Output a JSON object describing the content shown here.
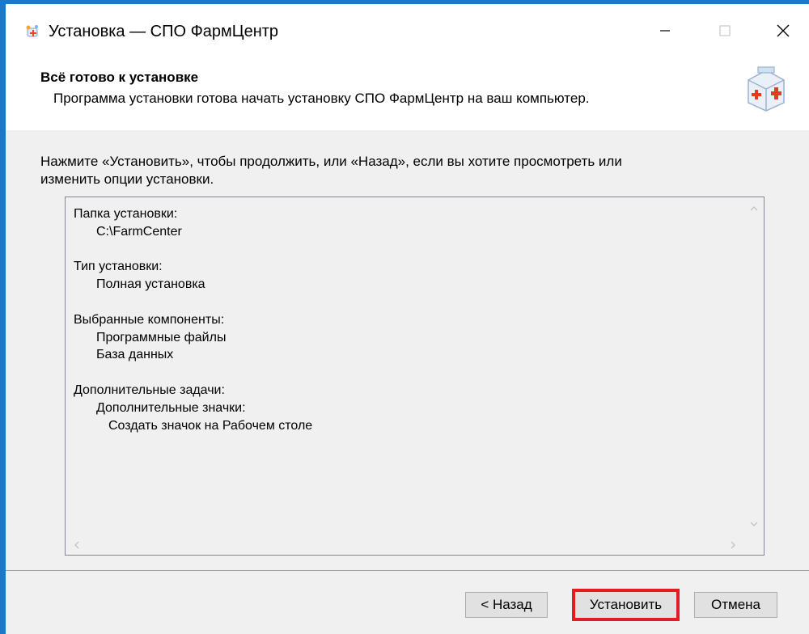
{
  "window": {
    "title": "Установка — СПО ФармЦентр",
    "accent_color": "#1979ca",
    "icon": "app-setup-icon"
  },
  "header": {
    "title": "Всё готово к установке",
    "subtitle": "Программа установки готова начать установку СПО ФармЦентр на ваш компьютер.",
    "logo": "first-aid-kit-icon"
  },
  "content": {
    "description_line1": "Нажмите «Установить», чтобы продолжить, или «Назад», если вы хотите просмотреть или",
    "description_line2": "изменить опции установки.",
    "memo": {
      "install_folder_label": "Папка установки:",
      "install_folder_value": "C:\\FarmCenter",
      "setup_type_label": "Тип установки:",
      "setup_type_value": "Полная установка",
      "components_label": "Выбранные компоненты:",
      "components": [
        "Программные файлы",
        "База данных"
      ],
      "tasks_label": "Дополнительные задачи:",
      "tasks_group": "Дополнительные значки:",
      "tasks_item": "Создать значок на Рабочем столе"
    }
  },
  "buttons": {
    "back": "< Назад",
    "install": "Установить",
    "cancel": "Отмена",
    "highlight_color": "#e31b23"
  }
}
